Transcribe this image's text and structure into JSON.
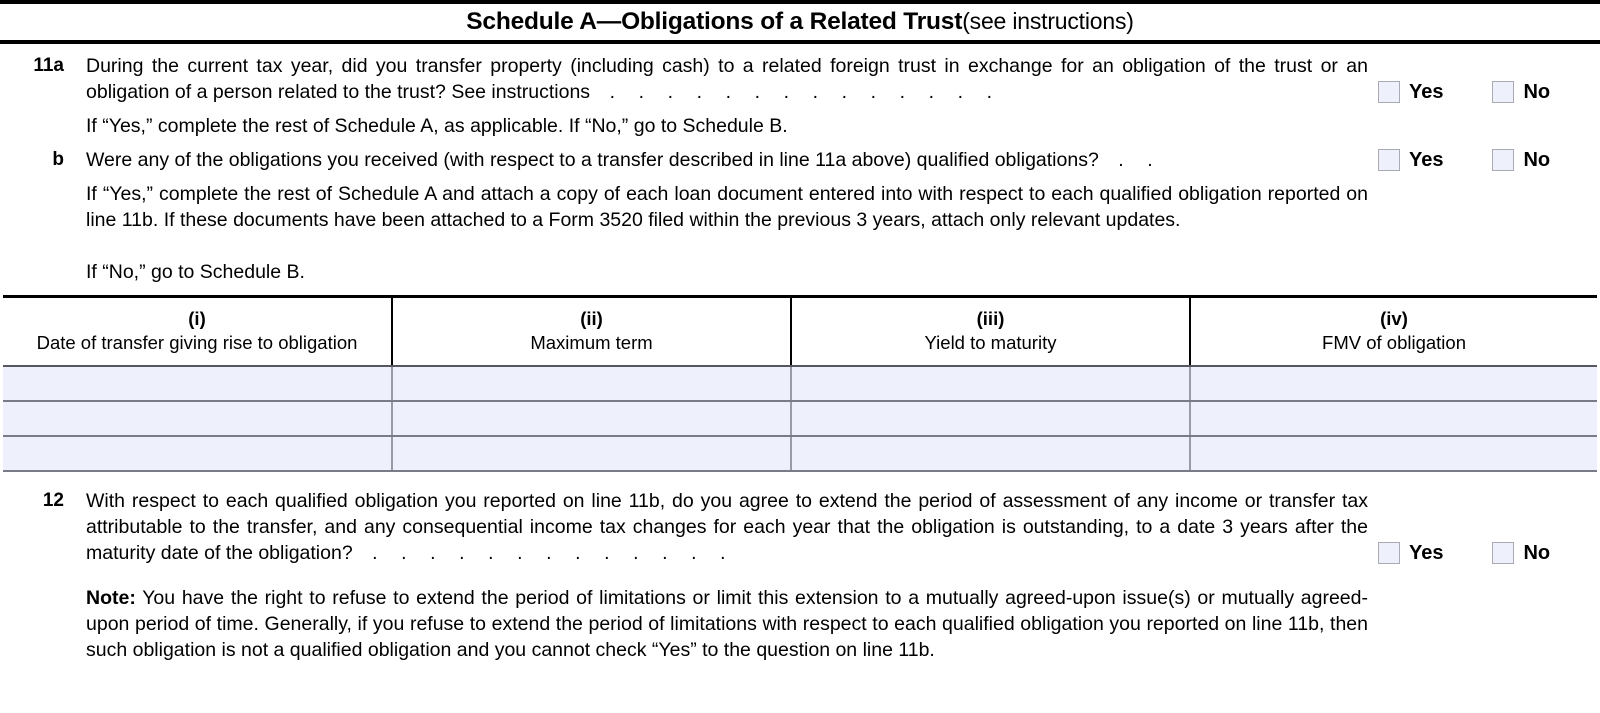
{
  "section": {
    "title_main": "Schedule A—Obligations of a Related Trust",
    "title_paren": "(see instructions)"
  },
  "line_11a": {
    "number": "11a",
    "text": "During the current tax year, did you transfer property (including cash) to a related foreign trust in exchange for an obligation of the trust or an obligation of a person related to the trust? See instructions",
    "followup": "If “Yes,” complete the rest of Schedule A, as applicable. If “No,” go to Schedule B.",
    "yes_label": "Yes",
    "no_label": "No",
    "yes_checked": false,
    "no_checked": false,
    "leader_count": 14
  },
  "line_11b": {
    "number": "b",
    "text": "Were any of the obligations you received (with respect to a transfer described in line 11a above) qualified obligations?",
    "followup": "If “Yes,” complete the rest of Schedule A and attach a copy of each loan document entered into with respect to each qualified obligation reported on line 11b. If these documents have been attached to a Form 3520 filed within the previous 3 years, attach only relevant updates.",
    "followup2": "If “No,” go to Schedule B.",
    "yes_label": "Yes",
    "no_label": "No",
    "yes_checked": false,
    "no_checked": false,
    "leader_count": 2
  },
  "obligations_table": {
    "columns": [
      {
        "numeral": "(i)",
        "label": "Date of transfer giving rise to obligation"
      },
      {
        "numeral": "(ii)",
        "label": "Maximum term"
      },
      {
        "numeral": "(iii)",
        "label": "Yield to maturity"
      },
      {
        "numeral": "(iv)",
        "label": "FMV of obligation"
      }
    ],
    "rows": [
      [
        "",
        "",
        "",
        ""
      ],
      [
        "",
        "",
        "",
        ""
      ],
      [
        "",
        "",
        "",
        ""
      ]
    ]
  },
  "line_12": {
    "number": "12",
    "text": "With respect to each qualified obligation you reported on line 11b, do you agree to extend the period of assessment of any income or transfer tax attributable to the transfer, and any consequential income tax changes for each year that the obligation is outstanding, to a date 3 years after the maturity date of the obligation?",
    "yes_label": "Yes",
    "no_label": "No",
    "yes_checked": false,
    "no_checked": false,
    "leader_count": 13
  },
  "note": {
    "label": "Note:",
    "text": " You have the right to refuse to extend the period of limitations or limit this extension to a mutually agreed-upon issue(s) or mutually agreed-upon period of time. Generally, if you refuse to extend the period of limitations with respect to each qualified obligation you reported on line 11b, then such obligation is not a qualified obligation and you cannot check “Yes” to the question on line 11b."
  },
  "colors": {
    "rule": "#000000",
    "checkbox_fill": "#eef1fb",
    "checkbox_border": "#a9aab4",
    "row_fill": "#eef1fb",
    "row_divider": "#7a7b87"
  }
}
